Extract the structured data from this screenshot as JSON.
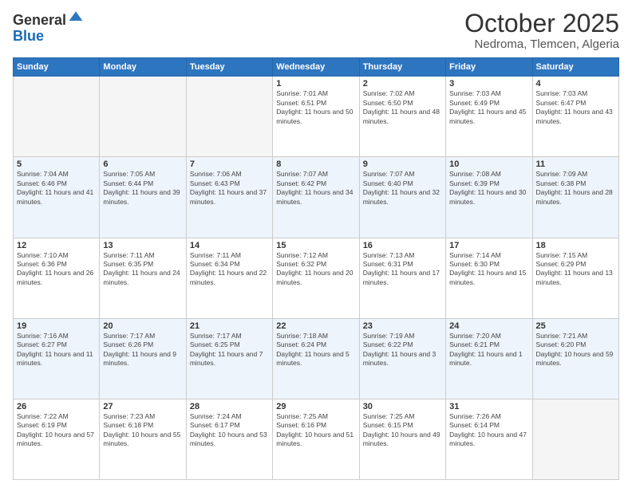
{
  "logo": {
    "general": "General",
    "blue": "Blue"
  },
  "header": {
    "month": "October 2025",
    "location": "Nedroma, Tlemcen, Algeria"
  },
  "weekdays": [
    "Sunday",
    "Monday",
    "Tuesday",
    "Wednesday",
    "Thursday",
    "Friday",
    "Saturday"
  ],
  "weeks": [
    [
      {
        "day": "",
        "sunrise": "",
        "sunset": "",
        "daylight": ""
      },
      {
        "day": "",
        "sunrise": "",
        "sunset": "",
        "daylight": ""
      },
      {
        "day": "",
        "sunrise": "",
        "sunset": "",
        "daylight": ""
      },
      {
        "day": "1",
        "sunrise": "Sunrise: 7:01 AM",
        "sunset": "Sunset: 6:51 PM",
        "daylight": "Daylight: 11 hours and 50 minutes."
      },
      {
        "day": "2",
        "sunrise": "Sunrise: 7:02 AM",
        "sunset": "Sunset: 6:50 PM",
        "daylight": "Daylight: 11 hours and 48 minutes."
      },
      {
        "day": "3",
        "sunrise": "Sunrise: 7:03 AM",
        "sunset": "Sunset: 6:49 PM",
        "daylight": "Daylight: 11 hours and 45 minutes."
      },
      {
        "day": "4",
        "sunrise": "Sunrise: 7:03 AM",
        "sunset": "Sunset: 6:47 PM",
        "daylight": "Daylight: 11 hours and 43 minutes."
      }
    ],
    [
      {
        "day": "5",
        "sunrise": "Sunrise: 7:04 AM",
        "sunset": "Sunset: 6:46 PM",
        "daylight": "Daylight: 11 hours and 41 minutes."
      },
      {
        "day": "6",
        "sunrise": "Sunrise: 7:05 AM",
        "sunset": "Sunset: 6:44 PM",
        "daylight": "Daylight: 11 hours and 39 minutes."
      },
      {
        "day": "7",
        "sunrise": "Sunrise: 7:06 AM",
        "sunset": "Sunset: 6:43 PM",
        "daylight": "Daylight: 11 hours and 37 minutes."
      },
      {
        "day": "8",
        "sunrise": "Sunrise: 7:07 AM",
        "sunset": "Sunset: 6:42 PM",
        "daylight": "Daylight: 11 hours and 34 minutes."
      },
      {
        "day": "9",
        "sunrise": "Sunrise: 7:07 AM",
        "sunset": "Sunset: 6:40 PM",
        "daylight": "Daylight: 11 hours and 32 minutes."
      },
      {
        "day": "10",
        "sunrise": "Sunrise: 7:08 AM",
        "sunset": "Sunset: 6:39 PM",
        "daylight": "Daylight: 11 hours and 30 minutes."
      },
      {
        "day": "11",
        "sunrise": "Sunrise: 7:09 AM",
        "sunset": "Sunset: 6:38 PM",
        "daylight": "Daylight: 11 hours and 28 minutes."
      }
    ],
    [
      {
        "day": "12",
        "sunrise": "Sunrise: 7:10 AM",
        "sunset": "Sunset: 6:36 PM",
        "daylight": "Daylight: 11 hours and 26 minutes."
      },
      {
        "day": "13",
        "sunrise": "Sunrise: 7:11 AM",
        "sunset": "Sunset: 6:35 PM",
        "daylight": "Daylight: 11 hours and 24 minutes."
      },
      {
        "day": "14",
        "sunrise": "Sunrise: 7:11 AM",
        "sunset": "Sunset: 6:34 PM",
        "daylight": "Daylight: 11 hours and 22 minutes."
      },
      {
        "day": "15",
        "sunrise": "Sunrise: 7:12 AM",
        "sunset": "Sunset: 6:32 PM",
        "daylight": "Daylight: 11 hours and 20 minutes."
      },
      {
        "day": "16",
        "sunrise": "Sunrise: 7:13 AM",
        "sunset": "Sunset: 6:31 PM",
        "daylight": "Daylight: 11 hours and 17 minutes."
      },
      {
        "day": "17",
        "sunrise": "Sunrise: 7:14 AM",
        "sunset": "Sunset: 6:30 PM",
        "daylight": "Daylight: 11 hours and 15 minutes."
      },
      {
        "day": "18",
        "sunrise": "Sunrise: 7:15 AM",
        "sunset": "Sunset: 6:29 PM",
        "daylight": "Daylight: 11 hours and 13 minutes."
      }
    ],
    [
      {
        "day": "19",
        "sunrise": "Sunrise: 7:16 AM",
        "sunset": "Sunset: 6:27 PM",
        "daylight": "Daylight: 11 hours and 11 minutes."
      },
      {
        "day": "20",
        "sunrise": "Sunrise: 7:17 AM",
        "sunset": "Sunset: 6:26 PM",
        "daylight": "Daylight: 11 hours and 9 minutes."
      },
      {
        "day": "21",
        "sunrise": "Sunrise: 7:17 AM",
        "sunset": "Sunset: 6:25 PM",
        "daylight": "Daylight: 11 hours and 7 minutes."
      },
      {
        "day": "22",
        "sunrise": "Sunrise: 7:18 AM",
        "sunset": "Sunset: 6:24 PM",
        "daylight": "Daylight: 11 hours and 5 minutes."
      },
      {
        "day": "23",
        "sunrise": "Sunrise: 7:19 AM",
        "sunset": "Sunset: 6:22 PM",
        "daylight": "Daylight: 11 hours and 3 minutes."
      },
      {
        "day": "24",
        "sunrise": "Sunrise: 7:20 AM",
        "sunset": "Sunset: 6:21 PM",
        "daylight": "Daylight: 11 hours and 1 minute."
      },
      {
        "day": "25",
        "sunrise": "Sunrise: 7:21 AM",
        "sunset": "Sunset: 6:20 PM",
        "daylight": "Daylight: 10 hours and 59 minutes."
      }
    ],
    [
      {
        "day": "26",
        "sunrise": "Sunrise: 7:22 AM",
        "sunset": "Sunset: 6:19 PM",
        "daylight": "Daylight: 10 hours and 57 minutes."
      },
      {
        "day": "27",
        "sunrise": "Sunrise: 7:23 AM",
        "sunset": "Sunset: 6:18 PM",
        "daylight": "Daylight: 10 hours and 55 minutes."
      },
      {
        "day": "28",
        "sunrise": "Sunrise: 7:24 AM",
        "sunset": "Sunset: 6:17 PM",
        "daylight": "Daylight: 10 hours and 53 minutes."
      },
      {
        "day": "29",
        "sunrise": "Sunrise: 7:25 AM",
        "sunset": "Sunset: 6:16 PM",
        "daylight": "Daylight: 10 hours and 51 minutes."
      },
      {
        "day": "30",
        "sunrise": "Sunrise: 7:25 AM",
        "sunset": "Sunset: 6:15 PM",
        "daylight": "Daylight: 10 hours and 49 minutes."
      },
      {
        "day": "31",
        "sunrise": "Sunrise: 7:26 AM",
        "sunset": "Sunset: 6:14 PM",
        "daylight": "Daylight: 10 hours and 47 minutes."
      },
      {
        "day": "",
        "sunrise": "",
        "sunset": "",
        "daylight": ""
      }
    ]
  ]
}
